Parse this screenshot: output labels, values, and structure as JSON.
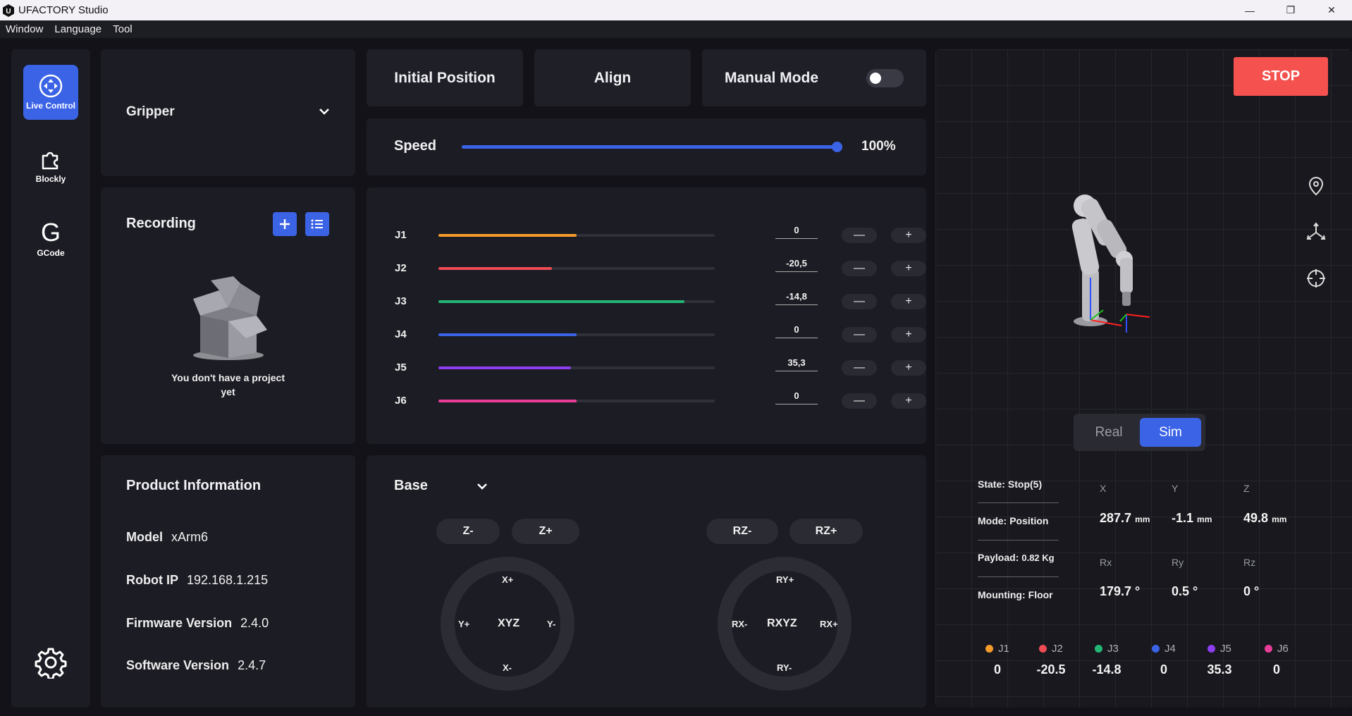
{
  "window": {
    "title": "UFACTORY Studio",
    "minimize": "—",
    "maximize": "❐",
    "close": "✕"
  },
  "menu": [
    "Window",
    "Language",
    "Tool"
  ],
  "nav": {
    "live_control": "Live Control",
    "blockly": "Blockly",
    "gcode": "GCode",
    "gcode_glyph": "G"
  },
  "gripper": {
    "label": "Gripper"
  },
  "recording": {
    "title": "Recording",
    "empty_text_1": "You don't have a project",
    "empty_text_2": "yet"
  },
  "product": {
    "title": "Product Information",
    "model_label": "Model",
    "model": "xArm6",
    "ip_label": "Robot IP",
    "ip": "192.168.1.215",
    "fw_label": "Firmware Version",
    "fw": "2.4.0",
    "sw_label": "Software Version",
    "sw": "2.4.7"
  },
  "top_buttons": {
    "initial": "Initial Position",
    "align": "Align",
    "manual": "Manual Mode",
    "manual_on": false
  },
  "speed": {
    "label": "Speed",
    "value_text": "100%",
    "value": 1.0
  },
  "joints": [
    {
      "name": "J1",
      "value": "0",
      "fill": 0.5,
      "color": "#f39a2b"
    },
    {
      "name": "J2",
      "value": "-20,5",
      "fill": 0.41,
      "color": "#ef4b55"
    },
    {
      "name": "J3",
      "value": "-14,8",
      "fill": 0.89,
      "color": "#22b574"
    },
    {
      "name": "J4",
      "value": "0",
      "fill": 0.5,
      "color": "#3b63e6"
    },
    {
      "name": "J5",
      "value": "35,3",
      "fill": 0.48,
      "color": "#8c3ef0"
    },
    {
      "name": "J6",
      "value": "0",
      "fill": 0.5,
      "color": "#e83d97"
    }
  ],
  "stepper": {
    "minus": "—",
    "plus": "+"
  },
  "base": {
    "label": "Base",
    "z_minus": "Z-",
    "z_plus": "Z+",
    "rz_minus": "RZ-",
    "rz_plus": "RZ+",
    "xyz": {
      "center": "XYZ",
      "top": "X+",
      "bottom": "X-",
      "left": "Y+",
      "right": "Y-"
    },
    "rxyz": {
      "center": "RXYZ",
      "top": "RY+",
      "bottom": "RY-",
      "left": "RX-",
      "right": "RX+"
    }
  },
  "stop": "STOP",
  "view_toggle": {
    "real": "Real",
    "sim": "Sim",
    "selected": "Sim"
  },
  "status": {
    "state_label": "State:",
    "state": "Stop(5)",
    "mode_label": "Mode:",
    "mode": "Position",
    "payload_label": "Payload:",
    "payload": "0.82 Kg",
    "mounting_label": "Mounting:",
    "mounting": "Floor"
  },
  "coords": {
    "x_h": "X",
    "y_h": "Y",
    "z_h": "Z",
    "x": "287.7",
    "y": "-1.1",
    "z": "49.8",
    "unit_mm": "mm",
    "rx_h": "Rx",
    "ry_h": "Ry",
    "rz_h": "Rz",
    "rx": "179.7 °",
    "ry": "0.5 °",
    "rz": "0 °"
  },
  "joint_legend": [
    {
      "name": "J1",
      "value": "0",
      "color": "#f39a2b"
    },
    {
      "name": "J2",
      "value": "-20.5",
      "color": "#ef4b55"
    },
    {
      "name": "J3",
      "value": "-14.8",
      "color": "#22b574"
    },
    {
      "name": "J4",
      "value": "0",
      "color": "#3b63e6"
    },
    {
      "name": "J5",
      "value": "35.3",
      "color": "#8c3ef0"
    },
    {
      "name": "J6",
      "value": "0",
      "color": "#e83d97"
    }
  ]
}
